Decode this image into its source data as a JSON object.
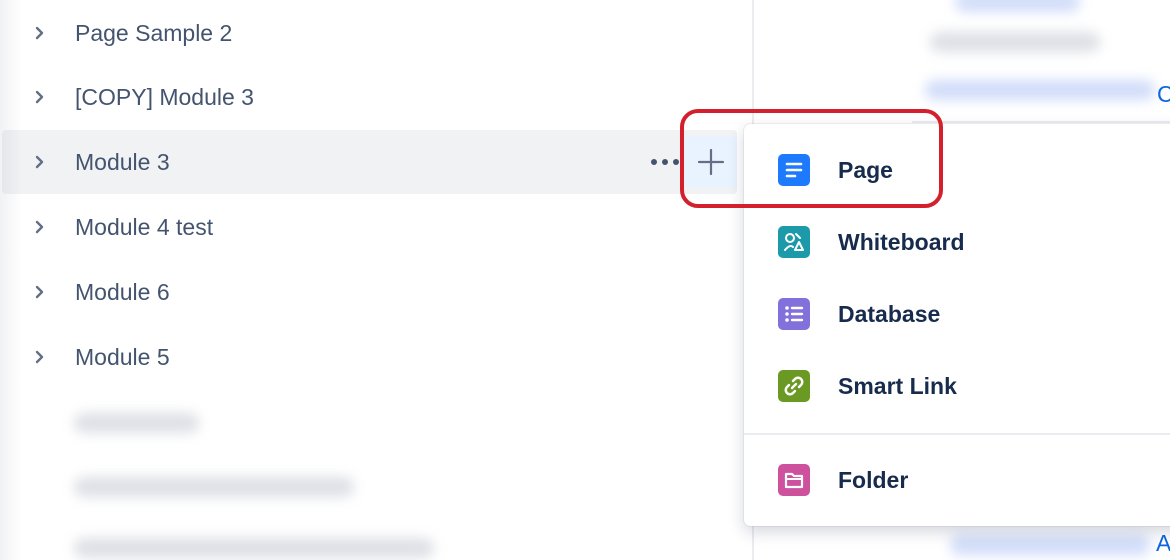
{
  "sidebar": {
    "items": [
      {
        "label": "Page Sample 2"
      },
      {
        "label": "[COPY] Module 3"
      },
      {
        "label": "Module 3"
      },
      {
        "label": "Module 4 test"
      },
      {
        "label": "Module 6"
      },
      {
        "label": "Module 5"
      }
    ],
    "hovered_index": 2,
    "row_actions": {
      "more_icon": "more-icon",
      "add_icon": "plus-icon"
    }
  },
  "create_menu": {
    "items": [
      {
        "label": "Page",
        "icon": "page-icon",
        "color": "#1d7afc"
      },
      {
        "label": "Whiteboard",
        "icon": "whiteboard-icon",
        "color": "#1d9aaa"
      },
      {
        "label": "Database",
        "icon": "database-icon",
        "color": "#8270db"
      },
      {
        "label": "Smart Link",
        "icon": "smart-link-icon",
        "color": "#6a9a23"
      },
      {
        "label": "Folder",
        "icon": "folder-icon",
        "color": "#cd519d"
      }
    ]
  },
  "right_panel": {
    "edge_text_top": "C",
    "edge_text_bottom": "A"
  },
  "colors": {
    "highlight": "#d4202d",
    "hover_row": "#f1f2f4",
    "add_button_bg": "#e9f2ff"
  }
}
